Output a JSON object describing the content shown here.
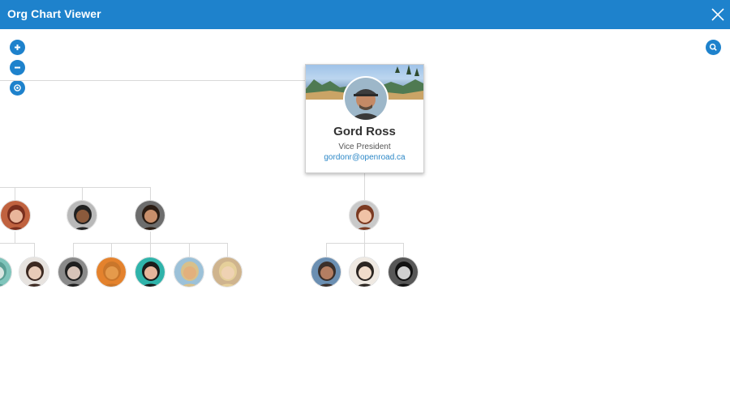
{
  "window": {
    "title": "Org Chart Viewer",
    "accent_color": "#1e82cc",
    "close_icon": "close-icon"
  },
  "controls": {
    "zoom_in_icon": "plus-icon",
    "zoom_out_icon": "minus-icon",
    "reset_icon": "target-icon",
    "search_icon": "search-icon"
  },
  "selected_card": {
    "name": "Gord Ross",
    "title": "Vice President",
    "email": "gordonr@openroad.ca"
  },
  "nodes": {
    "second_level": [
      {
        "id": "manager-1",
        "hair": "#7a2f1e",
        "skin": "#e9b69b",
        "bg": "#c0623f"
      },
      {
        "id": "manager-2",
        "hair": "#222222",
        "skin": "#8b5a3c",
        "bg": "#b9b9b9"
      },
      {
        "id": "manager-3",
        "hair": "#2b1d14",
        "skin": "#c98f6b",
        "bg": "#6d6d6d"
      },
      {
        "id": "manager-4",
        "hair": "#7b3a22",
        "skin": "#f0c2a6",
        "bg": "#c9c9c9"
      }
    ],
    "third_level": [
      {
        "id": "report-1",
        "hair": "#5a9e94",
        "skin": "#d9e6e2",
        "bg": "#7fc4bb"
      },
      {
        "id": "report-2",
        "hair": "#3d2a22",
        "skin": "#e8cbb8",
        "bg": "#e7e3df"
      },
      {
        "id": "report-3",
        "hair": "#1f1f1f",
        "skin": "#d7c3b8",
        "bg": "#8a8a8a"
      },
      {
        "id": "report-4",
        "hair": "#c9762b",
        "skin": "#e59a4b",
        "bg": "#e4822d"
      },
      {
        "id": "report-5",
        "hair": "#1b1b1b",
        "skin": "#e6b59b",
        "bg": "#2fb3aa"
      },
      {
        "id": "report-6",
        "hair": "#d8c08a",
        "skin": "#e2b07d",
        "bg": "#9cc1d8"
      },
      {
        "id": "report-7",
        "hair": "#e5cf9a",
        "skin": "#efd2b3",
        "bg": "#cfb48e"
      },
      {
        "id": "report-8",
        "hair": "#3b2f2a",
        "skin": "#b47e62",
        "bg": "#6b8fb2"
      },
      {
        "id": "report-9",
        "hair": "#2c2622",
        "skin": "#f1dccb",
        "bg": "#efe9e2"
      },
      {
        "id": "report-10",
        "hair": "#111111",
        "skin": "#cfcfcf",
        "bg": "#575757"
      }
    ]
  }
}
